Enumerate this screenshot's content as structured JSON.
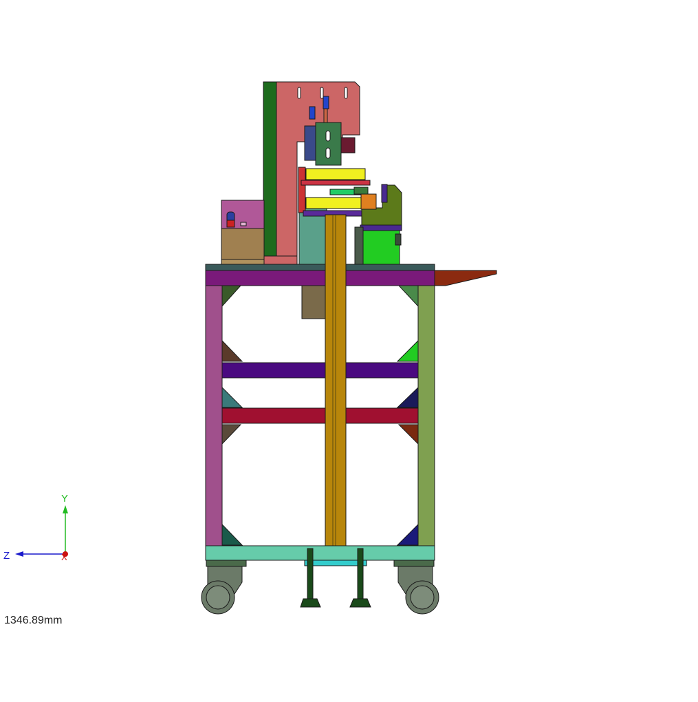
{
  "scale_label": "1346.89mm",
  "triad": {
    "y_label": "Y",
    "z_label": "Z",
    "x_label": "X",
    "y_color": "#22bb22",
    "z_color": "#1a1acc",
    "x_color": "#cc1111"
  },
  "palette": {
    "edge": "#1a1a1a",
    "backplate": "#cc6666",
    "green_strip": "#1d6b1d",
    "tabletop": "#7a1a7a",
    "left_leg": "#a0508c",
    "right_leg": "#7fa050",
    "column": "#b8860b",
    "crossbar_purple": "#4a0a80",
    "crossbar_red": "#a01030",
    "base_frame": "#66ccaa",
    "wheel": "#6b7a68",
    "olive_block": "#5c7a1a",
    "bright_green": "#22cc22",
    "yellow_roller": "#f0f020",
    "side_tray": "#8b2a10",
    "box_lid": "#b05898",
    "box_body": "#a08050",
    "teal": "#5aa08a",
    "leveler": "#1a4a1a"
  }
}
